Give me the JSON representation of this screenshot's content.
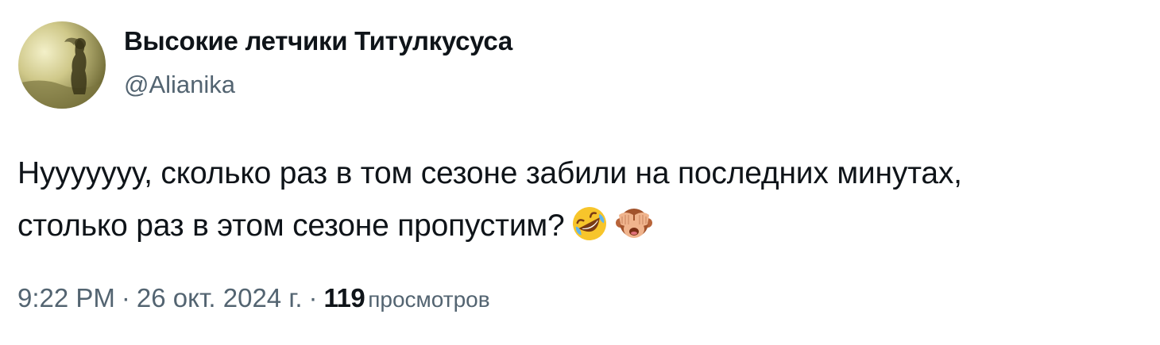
{
  "author": {
    "display_name": "Высокие летчики Титулкусуса",
    "handle": "@Alianika",
    "avatar_icon": "avatar-image"
  },
  "tweet": {
    "lines": [
      "Нууууууу, сколько раз в том сезоне забили на последних минутах,",
      "столько раз в этом сезоне пропустим?"
    ],
    "emojis": [
      "rolling-on-floor-laughing-emoji",
      "see-no-evil-monkey-emoji"
    ]
  },
  "meta": {
    "time": "9:22 PM",
    "separator": "·",
    "date": "26 окт. 2024 г.",
    "views_count": "119",
    "views_label": "просмотров"
  },
  "colors": {
    "text_primary": "#0f1419",
    "text_secondary": "#536471",
    "background": "#ffffff"
  }
}
